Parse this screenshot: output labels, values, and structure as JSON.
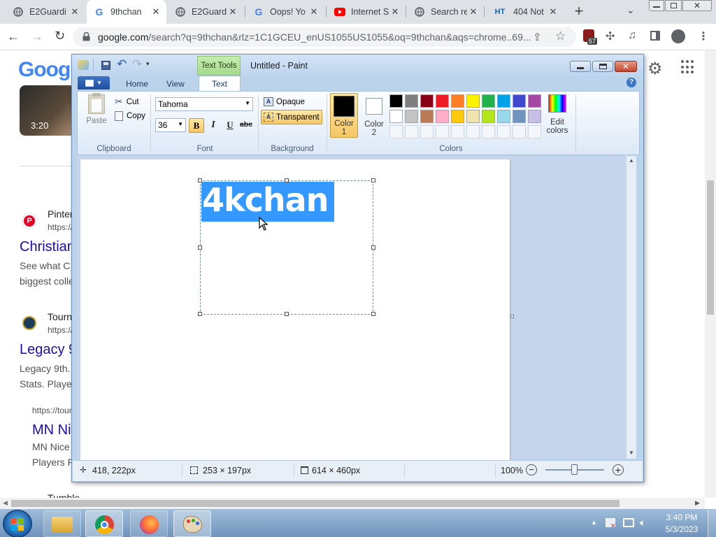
{
  "browser": {
    "tabs": [
      {
        "title": "E2Guardi",
        "icon": "globe-icon"
      },
      {
        "title": "9thchan",
        "icon": "google-icon",
        "active": true
      },
      {
        "title": "E2Guardi",
        "icon": "globe-icon"
      },
      {
        "title": "Oops! Yo",
        "icon": "google-icon"
      },
      {
        "title": "Internet S",
        "icon": "youtube-icon"
      },
      {
        "title": "Search re",
        "icon": "globe-icon"
      },
      {
        "title": "404 Not",
        "icon": "ht-icon",
        "icon_text": "HT"
      }
    ],
    "url_host": "google.com",
    "url_rest": "/search?q=9thchan&rlz=1C1GCEU_enUS1055US1055&oq=9thchan&aqs=chrome..69...",
    "extension_badge": "57"
  },
  "google_page": {
    "logo": "Google",
    "video_duration": "3:20",
    "result1_site": "Pinter",
    "result1_url": "https://",
    "result1_title": "Christian",
    "result1_snippet1": "See what C",
    "result1_snippet2": "biggest colle",
    "result2_site": "Tourn",
    "result2_url": "https://",
    "result2_title": "Legacy 9",
    "result2_snippet1": "Legacy 9th.",
    "result2_snippet2": "Stats. Playe",
    "result3_url": "https://tour",
    "result3_title": "MN Ni",
    "result3_snippet1": "MN Nice",
    "result3_snippet2": "Players F",
    "result4_site": "Tumble"
  },
  "paint": {
    "title": "Untitled - Paint",
    "context_tab": "Text Tools",
    "tabs": [
      "Home",
      "View",
      "Text"
    ],
    "active_tab": "Text",
    "clipboard": {
      "paste": "Paste",
      "cut": "Cut",
      "copy": "Copy",
      "label": "Clipboard"
    },
    "font": {
      "family": "Tahoma",
      "size": "36",
      "bold": "B",
      "italic": "I",
      "underline": "U",
      "strike": "abc",
      "label": "Font"
    },
    "background": {
      "opaque": "Opaque",
      "transparent": "Transparent",
      "label": "Background"
    },
    "colors": {
      "color1": "Color 1",
      "color1_line1": "Color",
      "color1_line2": "1",
      "color2_line1": "Color",
      "color2_line2": "2",
      "edit_line1": "Edit",
      "edit_line2": "colors",
      "label": "Colors",
      "palette_row1": [
        "#000000",
        "#7f7f7f",
        "#880015",
        "#ed1c24",
        "#ff7f27",
        "#fff200",
        "#22b14c",
        "#00a2e8",
        "#3f48cc",
        "#a349a4"
      ],
      "palette_row2": [
        "#ffffff",
        "#c3c3c3",
        "#b97a57",
        "#ffaec9",
        "#ffc90e",
        "#efe4b0",
        "#b5e61d",
        "#99d9ea",
        "#7092be",
        "#c8bfe7"
      ],
      "color1_value": "#000000",
      "color2_value": "#ffffff"
    },
    "canvas_text": "4kchan",
    "status": {
      "cursor_pos": "418, 222px",
      "selection_size": "253 × 197px",
      "image_size": "614 × 460px",
      "zoom": "100%"
    }
  },
  "taskbar": {
    "time": "3:40 PM",
    "date": "5/3/2023"
  }
}
